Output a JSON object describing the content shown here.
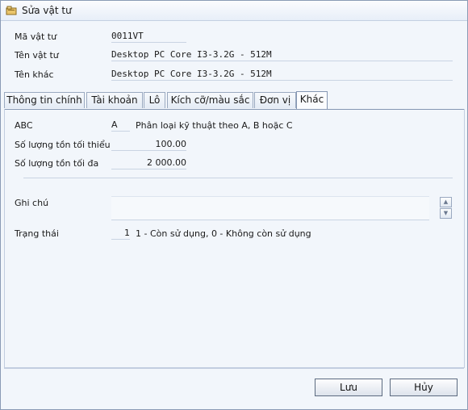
{
  "window": {
    "title": "Sửa vật tư"
  },
  "header_fields": [
    {
      "label": "Mã vật tư",
      "value": "0011VT"
    },
    {
      "label": "Tên vật tư",
      "value": "Desktop PC Core I3-3.2G - 512M"
    },
    {
      "label": "Tên khác",
      "value": "Desktop PC Core I3-3.2G - 512M"
    }
  ],
  "tabs": [
    {
      "label": "Thông tin chính"
    },
    {
      "label": "Tài khoản"
    },
    {
      "label": "Lô"
    },
    {
      "label": "Kích cỡ/màu sắc"
    },
    {
      "label": "Đơn vị"
    },
    {
      "label": "Khác",
      "active": true
    }
  ],
  "other": {
    "abc_label": "ABC",
    "abc_value": "A",
    "abc_hint": "Phân loại kỹ thuật theo A, B hoặc C",
    "min_stock_label": "Số lượng tồn tối thiểu",
    "min_stock_value": "100.00",
    "max_stock_label": "Số lượng tồn tối đa",
    "max_stock_value": "2 000.00",
    "note_label": "Ghi chú",
    "note_value": "",
    "status_label": "Trạng thái",
    "status_value": "1",
    "status_hint": "1 - Còn sử dụng, 0 - Không còn sử dụng"
  },
  "buttons": {
    "save": "Lưu",
    "cancel": "Hủy"
  },
  "icons": {
    "title": "edit-item-icon",
    "scroll_up": "scroll-up-icon",
    "scroll_down": "scroll-down-icon"
  }
}
